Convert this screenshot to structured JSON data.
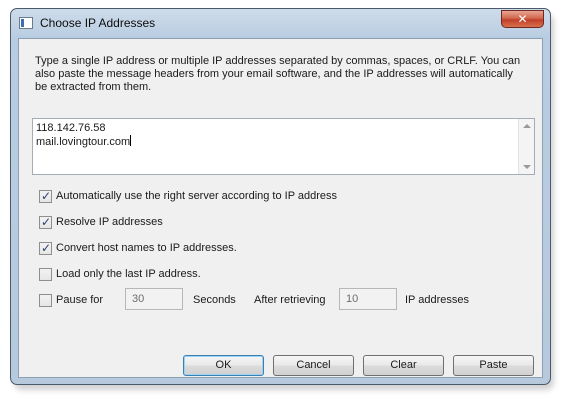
{
  "window": {
    "title": "Choose IP Addresses",
    "close_label": "✕"
  },
  "description": "Type a single IP address or multiple IP addresses separated by commas, spaces, or CRLF. You can also paste the message headers from your email software, and the IP addresses will automatically be extracted from them.",
  "input": {
    "lines": [
      "118.142.76.58",
      "mail.lovingtour.com"
    ]
  },
  "options": [
    {
      "label": "Automatically use the right server according to IP address",
      "checked": true
    },
    {
      "label": "Resolve IP addresses",
      "checked": true
    },
    {
      "label": "Convert host names to IP addresses.",
      "checked": true
    },
    {
      "label": "Load only the last IP address.",
      "checked": false
    },
    {
      "label": "Pause for",
      "checked": false
    }
  ],
  "pause": {
    "seconds_value": "30",
    "seconds_label": "Seconds",
    "after_label": "After retrieving",
    "count_value": "10",
    "count_label": "IP addresses"
  },
  "buttons": {
    "ok": "OK",
    "cancel": "Cancel",
    "clear": "Clear",
    "paste": "Paste"
  },
  "colors": {
    "titlebar": "#b9cde2",
    "client_bg": "#f0f0f0",
    "close_button": "#c0402a",
    "default_button_border": "#3c7fb1"
  }
}
